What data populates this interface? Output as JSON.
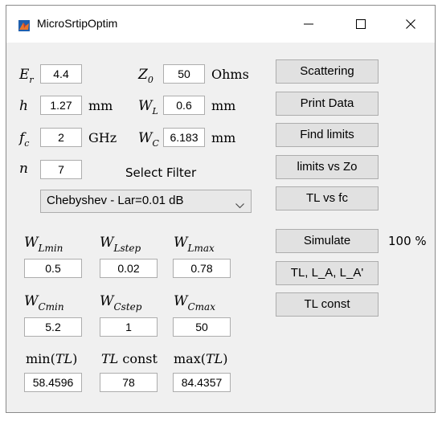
{
  "window": {
    "title": "MicroSrtipOptim",
    "minimize_glyph": "—",
    "maximize_glyph": "☐",
    "close_glyph": "✕",
    "app_icon": "matlab-icon"
  },
  "params": {
    "er": {
      "sym": "E",
      "sub": "r",
      "value": "4.4"
    },
    "z0": {
      "sym": "Z",
      "sub": "0",
      "value": "50",
      "unit": "Ohms"
    },
    "h": {
      "sym": "h",
      "value": "1.27",
      "unit": "mm"
    },
    "wl": {
      "sym": "W",
      "sub": "L",
      "value": "0.6",
      "unit": "mm"
    },
    "fc": {
      "sym": "f",
      "sub": "c",
      "value": "2",
      "unit": "GHz"
    },
    "wc": {
      "sym": "W",
      "sub": "C",
      "value": "6.183",
      "unit": "mm"
    },
    "n": {
      "sym": "n",
      "value": "7"
    }
  },
  "filter": {
    "label": "Select Filter",
    "selected": "Chebyshev - Lar=0.01 dB"
  },
  "buttons": {
    "scattering": "Scattering",
    "print_data": "Print Data",
    "find_limits": "Find limits",
    "limits_vs_zo": "limits vs Zo",
    "tl_vs_fc": "TL vs fc",
    "simulate": "Simulate",
    "tl_la": "TL, L_A, L_A'",
    "tl_const": "TL const"
  },
  "progress_text": "100 %",
  "sweep": {
    "wlmin": {
      "sym": "W",
      "sub": "Lmin",
      "value": "0.5"
    },
    "wlstep": {
      "sym": "W",
      "sub": "Lstep",
      "value": "0.02"
    },
    "wlmax": {
      "sym": "W",
      "sub": "Lmax",
      "value": "0.78"
    },
    "wcmin": {
      "sym": "W",
      "sub": "Cmin",
      "value": "5.2"
    },
    "wcstep": {
      "sym": "W",
      "sub": "Cstep",
      "value": "1"
    },
    "wcmax": {
      "sym": "W",
      "sub": "Cmax",
      "value": "50"
    }
  },
  "results": {
    "min_label_pre": "min(",
    "min_label_var": "TL",
    "min_label_post": ")",
    "min_value": "58.4596",
    "const_label_var": "TL",
    "const_label_post": " const",
    "const_value": "78",
    "max_label_pre": "max(",
    "max_label_var": "TL",
    "max_label_post": ")",
    "max_value": "84.4357"
  }
}
